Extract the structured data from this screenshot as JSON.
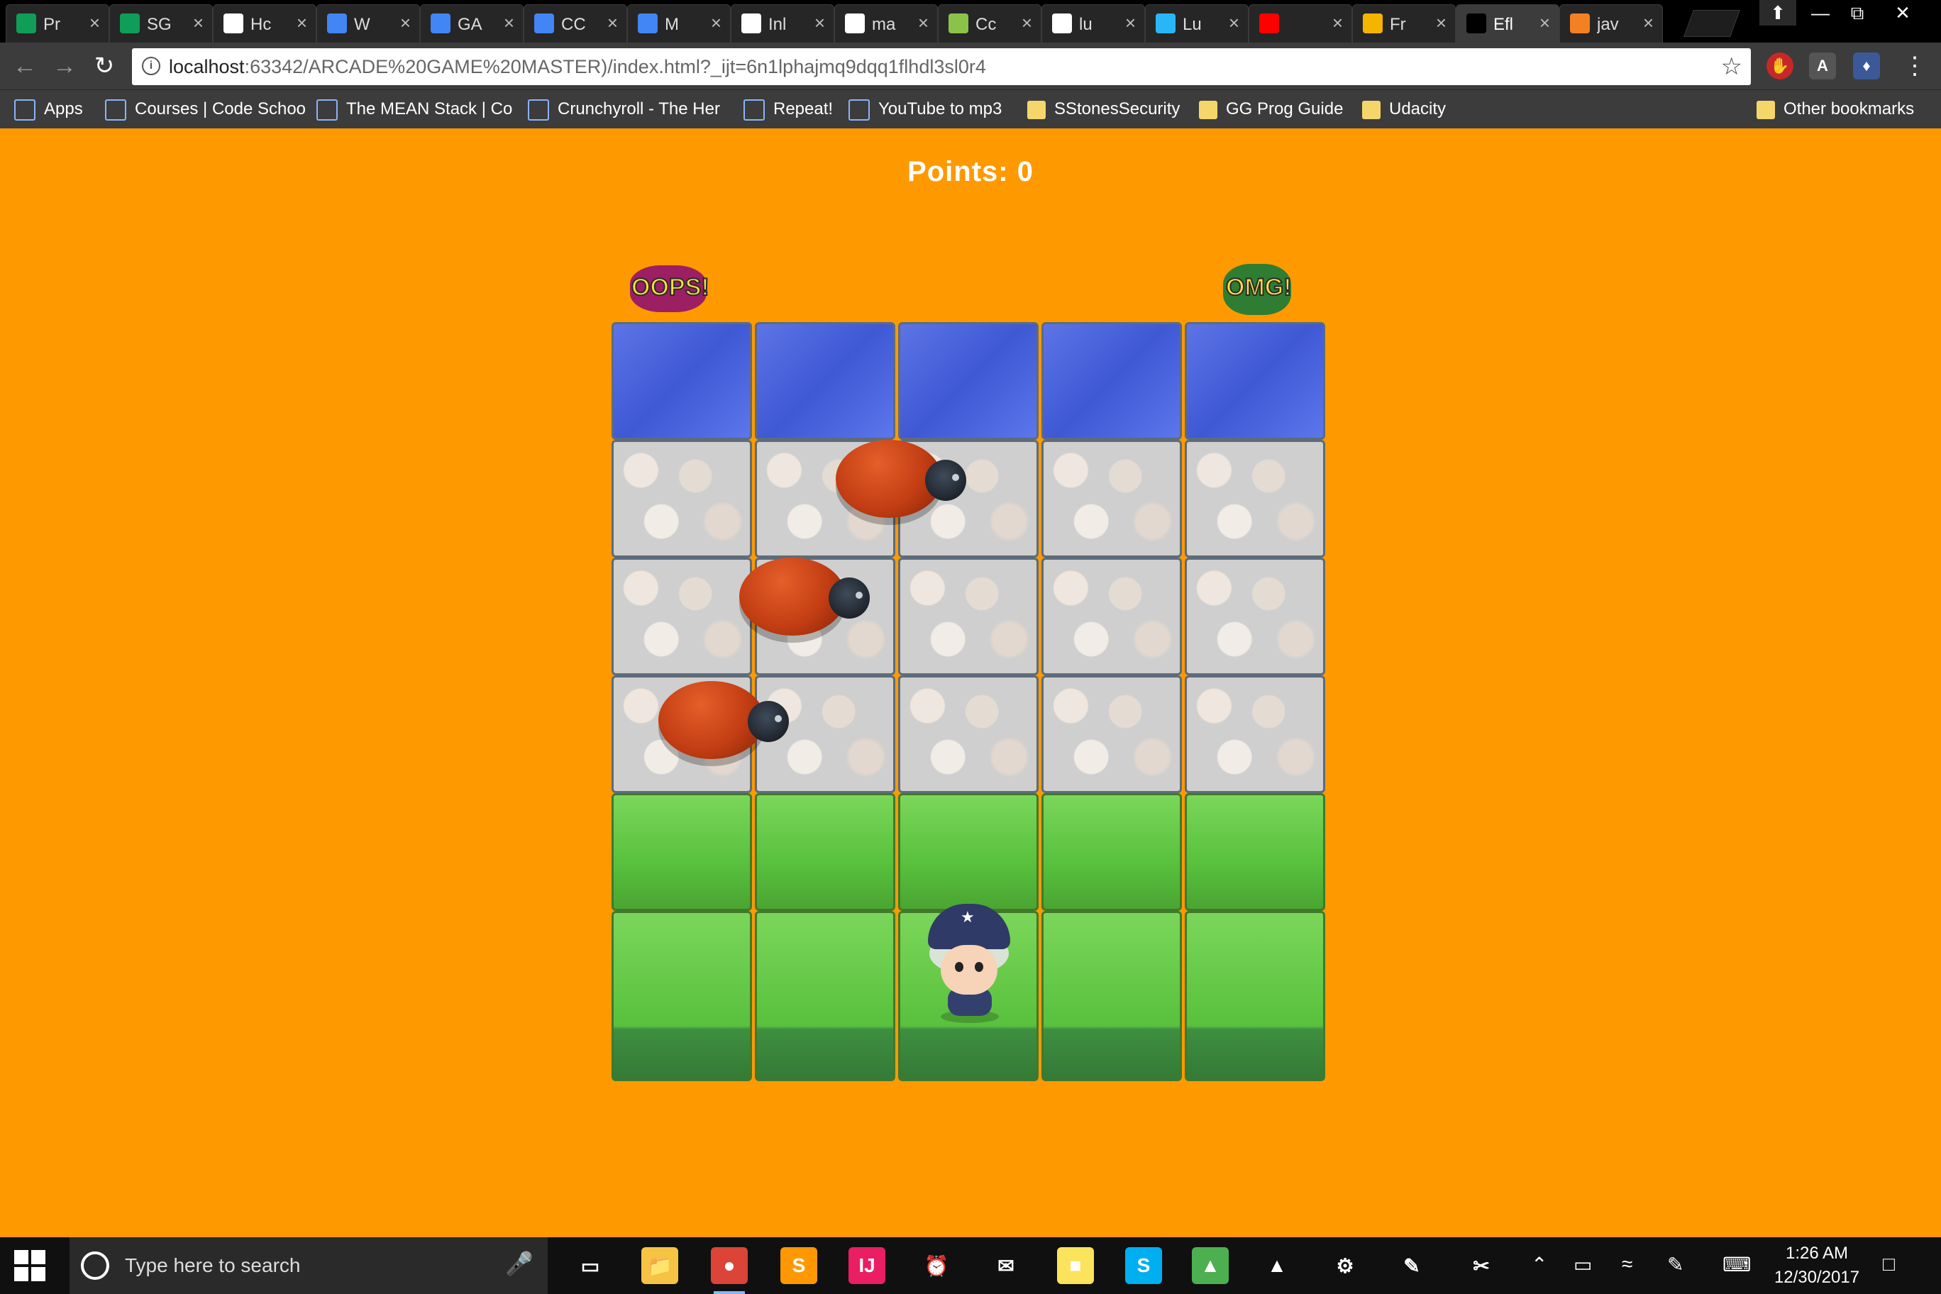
{
  "browser": {
    "tabs": [
      {
        "title": "Pr",
        "icon": "sheets-icon",
        "color": "#0f9d58"
      },
      {
        "title": "SG",
        "icon": "sheets-icon",
        "color": "#0f9d58"
      },
      {
        "title": "Hc",
        "icon": "library-icon",
        "color": "#ffffff"
      },
      {
        "title": "W",
        "icon": "docs-icon",
        "color": "#4285f4"
      },
      {
        "title": "GA",
        "icon": "docs-icon",
        "color": "#4285f4"
      },
      {
        "title": "CC",
        "icon": "docs-icon",
        "color": "#4285f4"
      },
      {
        "title": "M",
        "icon": "docs-icon",
        "color": "#4285f4"
      },
      {
        "title": "Inl",
        "icon": "gmail-icon",
        "color": "#ffffff"
      },
      {
        "title": "ma",
        "icon": "wiki-icon",
        "color": "#ffffff"
      },
      {
        "title": "Cc",
        "icon": "image-icon",
        "color": "#8bc34a"
      },
      {
        "title": "lu",
        "icon": "google-icon",
        "color": "#ffffff"
      },
      {
        "title": "Lu",
        "icon": "wave-icon",
        "color": "#29b6f6"
      },
      {
        "title": "",
        "icon": "youtube-icon",
        "color": "#ff0000"
      },
      {
        "title": "Fr",
        "icon": "slides-icon",
        "color": "#f4b400"
      },
      {
        "title": "Efl",
        "icon": "intellij-icon",
        "color": "#000000"
      },
      {
        "title": "jav",
        "icon": "stackoverflow-icon",
        "color": "#f48024"
      }
    ],
    "active_tab_index": 14,
    "window_controls": [
      "⬆",
      "—",
      "⧉",
      "✕"
    ],
    "address": {
      "host": "localhost",
      "path": ":63342/ARCADE%20GAME%20MASTER)/index.html?_ijt=6n1lphajmq9dqq1flhdl3sl0r4"
    },
    "bookmarks": [
      {
        "label": "Apps",
        "icon": "apps-grid-icon"
      },
      {
        "label": "Courses | Code Schoo",
        "icon": "code-icon"
      },
      {
        "label": "The MEAN Stack | Co",
        "icon": "code-icon"
      },
      {
        "label": "Crunchyroll - The Her",
        "icon": "crunchyroll-icon"
      },
      {
        "label": "Repeat!",
        "icon": "page-icon"
      },
      {
        "label": "YouTube to mp3",
        "icon": "download-icon"
      },
      {
        "label": "SStonesSecurity",
        "icon": "folder-icon"
      },
      {
        "label": "GG Prog Guide",
        "icon": "folder-icon"
      },
      {
        "label": "Udacity",
        "icon": "folder-icon"
      }
    ],
    "other_bookmarks": "Other bookmarks"
  },
  "game": {
    "points_label": "Points: 0",
    "badge_left": "OOPS!",
    "badge_right": "OMG!",
    "rows": [
      "water",
      "stone",
      "stone",
      "stone",
      "grass",
      "grass"
    ],
    "columns": 5,
    "player_cell": {
      "row": 5,
      "col": 2
    },
    "colors": {
      "background": "#ff9900",
      "enemy": "#c23d13",
      "water": "#4a63dc",
      "grass": "#58c13d"
    }
  },
  "taskbar": {
    "search_placeholder": "Type here to search",
    "time": "1:26 AM",
    "date": "12/30/2017",
    "apps": [
      {
        "name": "task-view-icon",
        "glyph": "▭",
        "color": "#101010"
      },
      {
        "name": "file-explorer-icon",
        "glyph": "📁",
        "color": "#f6c344"
      },
      {
        "name": "chrome-icon",
        "glyph": "●",
        "color": "#db4437",
        "active": true
      },
      {
        "name": "sublime-icon",
        "glyph": "S",
        "color": "#ff9800"
      },
      {
        "name": "intellij-icon",
        "glyph": "IJ",
        "color": "#e91e63"
      },
      {
        "name": "alarm-icon",
        "glyph": "⏰",
        "color": "#101010"
      },
      {
        "name": "mail-icon",
        "glyph": "✉",
        "color": "#101010"
      },
      {
        "name": "sticky-notes-icon",
        "glyph": "■",
        "color": "#fbe45b"
      },
      {
        "name": "skype-icon",
        "glyph": "S",
        "color": "#00aff0"
      },
      {
        "name": "photos-icon",
        "glyph": "▲",
        "color": "#4caf50"
      },
      {
        "name": "gallery-icon",
        "glyph": "▲",
        "color": "#101010"
      },
      {
        "name": "settings-icon",
        "glyph": "⚙",
        "color": "#101010"
      },
      {
        "name": "paint-icon",
        "glyph": "✎",
        "color": "#101010"
      },
      {
        "name": "snipping-icon",
        "glyph": "✂",
        "color": "#101010"
      }
    ]
  }
}
